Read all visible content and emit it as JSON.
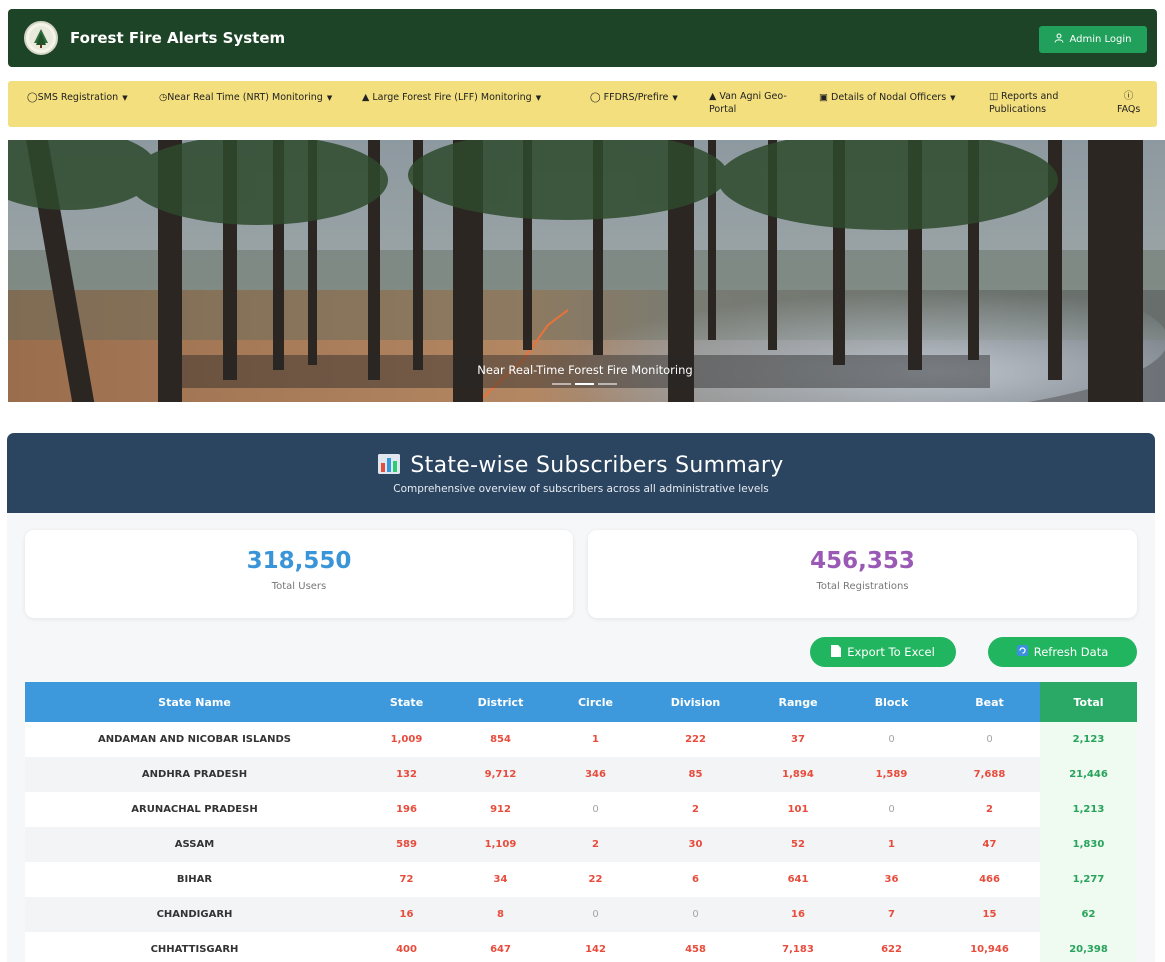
{
  "app": {
    "title": "Forest Fire Alerts System",
    "admin_login": "Admin Login"
  },
  "nav": [
    {
      "label": "SMS Registration",
      "icon": "chat-icon",
      "dropdown": true
    },
    {
      "label": "Near Real Time (NRT) Monitoring",
      "icon": "clock-icon",
      "dropdown": true
    },
    {
      "label": "Large Forest Fire (LFF) Monitoring",
      "icon": "fire-icon",
      "dropdown": true
    },
    {
      "label": "FFDRS/Prefire",
      "icon": "shield-icon",
      "dropdown": true
    },
    {
      "label_line1": "Van Agni Geo-",
      "label_line2": "Portal",
      "icon": "fire-icon",
      "dropdown": false
    },
    {
      "label": "Details of Nodal Officers",
      "icon": "id-card-icon",
      "dropdown": true
    },
    {
      "label_line1": "Reports and",
      "label_line2": "Publications",
      "icon": "document-icon",
      "dropdown": false
    },
    {
      "label": "FAQs",
      "icon": "question-icon",
      "dropdown": false
    }
  ],
  "hero": {
    "caption": "Near Real-Time Forest Fire Monitoring",
    "slides": 3,
    "active_slide": 2
  },
  "summary": {
    "title": "State-wise Subscribers Summary",
    "subtitle": "Comprehensive overview of subscribers across all administrative levels",
    "total_users_value": "318,550",
    "total_users_label": "Total Users",
    "total_registrations_value": "456,353",
    "total_registrations_label": "Total Registrations",
    "export_label": "Export To Excel",
    "refresh_label": "Refresh Data"
  },
  "table": {
    "headers": [
      "State Name",
      "State",
      "District",
      "Circle",
      "Division",
      "Range",
      "Block",
      "Beat",
      "Total"
    ],
    "rows": [
      [
        "ANDAMAN AND NICOBAR ISLANDS",
        "1,009",
        "854",
        "1",
        "222",
        "37",
        "0",
        "0",
        "2,123"
      ],
      [
        "ANDHRA PRADESH",
        "132",
        "9,712",
        "346",
        "85",
        "1,894",
        "1,589",
        "7,688",
        "21,446"
      ],
      [
        "ARUNACHAL PRADESH",
        "196",
        "912",
        "0",
        "2",
        "101",
        "0",
        "2",
        "1,213"
      ],
      [
        "ASSAM",
        "589",
        "1,109",
        "2",
        "30",
        "52",
        "1",
        "47",
        "1,830"
      ],
      [
        "BIHAR",
        "72",
        "34",
        "22",
        "6",
        "641",
        "36",
        "466",
        "1,277"
      ],
      [
        "CHANDIGARH",
        "16",
        "8",
        "0",
        "0",
        "16",
        "7",
        "15",
        "62"
      ],
      [
        "CHHATTISGARH",
        "400",
        "647",
        "142",
        "458",
        "7,183",
        "622",
        "10,946",
        "20,398"
      ]
    ]
  },
  "colors": {
    "header_green": "#1e4427",
    "nav_yellow": "#f3df7e",
    "summary_header": "#2b4460",
    "users_blue": "#3a95d8",
    "registrations_purple": "#9b59b6",
    "value_red": "#e74c3c",
    "total_green": "#27a35b"
  }
}
